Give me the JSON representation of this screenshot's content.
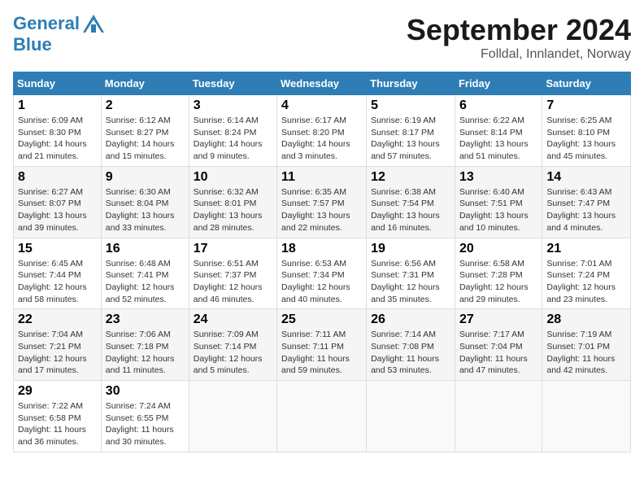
{
  "header": {
    "logo_line1": "General",
    "logo_line2": "Blue",
    "month_title": "September 2024",
    "location": "Folldal, Innlandet, Norway"
  },
  "days_of_week": [
    "Sunday",
    "Monday",
    "Tuesday",
    "Wednesday",
    "Thursday",
    "Friday",
    "Saturday"
  ],
  "weeks": [
    [
      {
        "num": "1",
        "sunrise": "Sunrise: 6:09 AM",
        "sunset": "Sunset: 8:30 PM",
        "daylight": "Daylight: 14 hours and 21 minutes."
      },
      {
        "num": "2",
        "sunrise": "Sunrise: 6:12 AM",
        "sunset": "Sunset: 8:27 PM",
        "daylight": "Daylight: 14 hours and 15 minutes."
      },
      {
        "num": "3",
        "sunrise": "Sunrise: 6:14 AM",
        "sunset": "Sunset: 8:24 PM",
        "daylight": "Daylight: 14 hours and 9 minutes."
      },
      {
        "num": "4",
        "sunrise": "Sunrise: 6:17 AM",
        "sunset": "Sunset: 8:20 PM",
        "daylight": "Daylight: 14 hours and 3 minutes."
      },
      {
        "num": "5",
        "sunrise": "Sunrise: 6:19 AM",
        "sunset": "Sunset: 8:17 PM",
        "daylight": "Daylight: 13 hours and 57 minutes."
      },
      {
        "num": "6",
        "sunrise": "Sunrise: 6:22 AM",
        "sunset": "Sunset: 8:14 PM",
        "daylight": "Daylight: 13 hours and 51 minutes."
      },
      {
        "num": "7",
        "sunrise": "Sunrise: 6:25 AM",
        "sunset": "Sunset: 8:10 PM",
        "daylight": "Daylight: 13 hours and 45 minutes."
      }
    ],
    [
      {
        "num": "8",
        "sunrise": "Sunrise: 6:27 AM",
        "sunset": "Sunset: 8:07 PM",
        "daylight": "Daylight: 13 hours and 39 minutes."
      },
      {
        "num": "9",
        "sunrise": "Sunrise: 6:30 AM",
        "sunset": "Sunset: 8:04 PM",
        "daylight": "Daylight: 13 hours and 33 minutes."
      },
      {
        "num": "10",
        "sunrise": "Sunrise: 6:32 AM",
        "sunset": "Sunset: 8:01 PM",
        "daylight": "Daylight: 13 hours and 28 minutes."
      },
      {
        "num": "11",
        "sunrise": "Sunrise: 6:35 AM",
        "sunset": "Sunset: 7:57 PM",
        "daylight": "Daylight: 13 hours and 22 minutes."
      },
      {
        "num": "12",
        "sunrise": "Sunrise: 6:38 AM",
        "sunset": "Sunset: 7:54 PM",
        "daylight": "Daylight: 13 hours and 16 minutes."
      },
      {
        "num": "13",
        "sunrise": "Sunrise: 6:40 AM",
        "sunset": "Sunset: 7:51 PM",
        "daylight": "Daylight: 13 hours and 10 minutes."
      },
      {
        "num": "14",
        "sunrise": "Sunrise: 6:43 AM",
        "sunset": "Sunset: 7:47 PM",
        "daylight": "Daylight: 13 hours and 4 minutes."
      }
    ],
    [
      {
        "num": "15",
        "sunrise": "Sunrise: 6:45 AM",
        "sunset": "Sunset: 7:44 PM",
        "daylight": "Daylight: 12 hours and 58 minutes."
      },
      {
        "num": "16",
        "sunrise": "Sunrise: 6:48 AM",
        "sunset": "Sunset: 7:41 PM",
        "daylight": "Daylight: 12 hours and 52 minutes."
      },
      {
        "num": "17",
        "sunrise": "Sunrise: 6:51 AM",
        "sunset": "Sunset: 7:37 PM",
        "daylight": "Daylight: 12 hours and 46 minutes."
      },
      {
        "num": "18",
        "sunrise": "Sunrise: 6:53 AM",
        "sunset": "Sunset: 7:34 PM",
        "daylight": "Daylight: 12 hours and 40 minutes."
      },
      {
        "num": "19",
        "sunrise": "Sunrise: 6:56 AM",
        "sunset": "Sunset: 7:31 PM",
        "daylight": "Daylight: 12 hours and 35 minutes."
      },
      {
        "num": "20",
        "sunrise": "Sunrise: 6:58 AM",
        "sunset": "Sunset: 7:28 PM",
        "daylight": "Daylight: 12 hours and 29 minutes."
      },
      {
        "num": "21",
        "sunrise": "Sunrise: 7:01 AM",
        "sunset": "Sunset: 7:24 PM",
        "daylight": "Daylight: 12 hours and 23 minutes."
      }
    ],
    [
      {
        "num": "22",
        "sunrise": "Sunrise: 7:04 AM",
        "sunset": "Sunset: 7:21 PM",
        "daylight": "Daylight: 12 hours and 17 minutes."
      },
      {
        "num": "23",
        "sunrise": "Sunrise: 7:06 AM",
        "sunset": "Sunset: 7:18 PM",
        "daylight": "Daylight: 12 hours and 11 minutes."
      },
      {
        "num": "24",
        "sunrise": "Sunrise: 7:09 AM",
        "sunset": "Sunset: 7:14 PM",
        "daylight": "Daylight: 12 hours and 5 minutes."
      },
      {
        "num": "25",
        "sunrise": "Sunrise: 7:11 AM",
        "sunset": "Sunset: 7:11 PM",
        "daylight": "Daylight: 11 hours and 59 minutes."
      },
      {
        "num": "26",
        "sunrise": "Sunrise: 7:14 AM",
        "sunset": "Sunset: 7:08 PM",
        "daylight": "Daylight: 11 hours and 53 minutes."
      },
      {
        "num": "27",
        "sunrise": "Sunrise: 7:17 AM",
        "sunset": "Sunset: 7:04 PM",
        "daylight": "Daylight: 11 hours and 47 minutes."
      },
      {
        "num": "28",
        "sunrise": "Sunrise: 7:19 AM",
        "sunset": "Sunset: 7:01 PM",
        "daylight": "Daylight: 11 hours and 42 minutes."
      }
    ],
    [
      {
        "num": "29",
        "sunrise": "Sunrise: 7:22 AM",
        "sunset": "Sunset: 6:58 PM",
        "daylight": "Daylight: 11 hours and 36 minutes."
      },
      {
        "num": "30",
        "sunrise": "Sunrise: 7:24 AM",
        "sunset": "Sunset: 6:55 PM",
        "daylight": "Daylight: 11 hours and 30 minutes."
      },
      null,
      null,
      null,
      null,
      null
    ]
  ]
}
